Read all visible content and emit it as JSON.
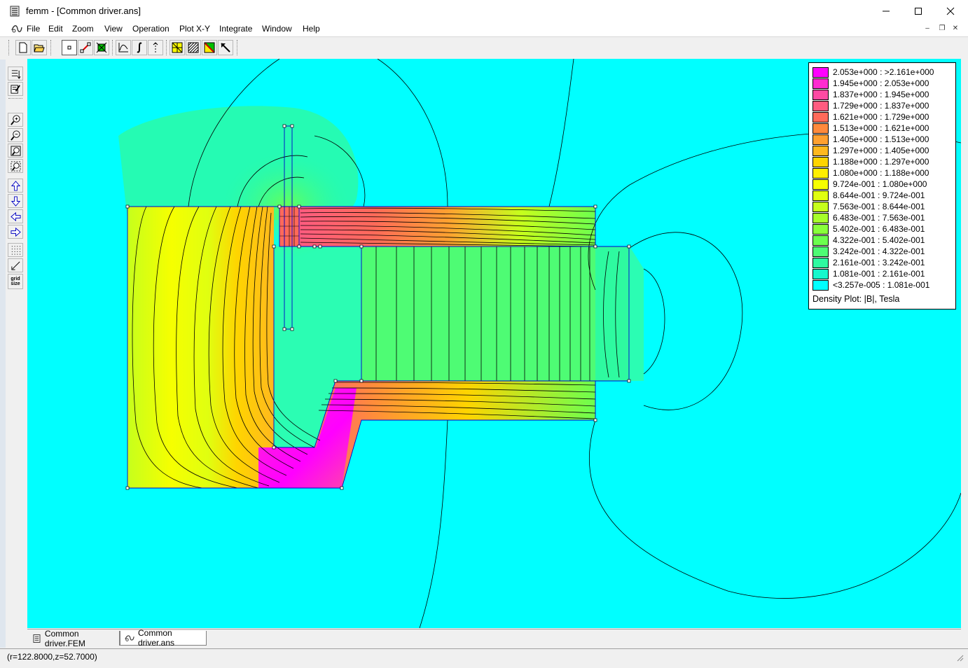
{
  "window": {
    "title": "femm - [Common driver.ans]",
    "app": "femm"
  },
  "menu": [
    "File",
    "Edit",
    "Zoom",
    "View",
    "Operation",
    "Plot X-Y",
    "Integrate",
    "Window",
    "Help"
  ],
  "toolbar": {
    "buttons": [
      "new-file-icon",
      "open-folder-icon",
      "point-mode-icon",
      "contour-mode-icon",
      "area-mode-icon",
      "plot-xy-icon",
      "integrate-icon",
      "line-integral-icon",
      "show-mesh-icon",
      "show-density-icon",
      "show-vector-icon",
      "select-arrow-icon"
    ]
  },
  "left_toolbar": {
    "buttons": [
      "show-points-icon",
      "edit-icon",
      "zoom-in-icon",
      "zoom-out-icon",
      "zoom-natural-icon",
      "zoom-window-icon",
      "pan-up-icon",
      "pan-down-icon",
      "pan-left-icon",
      "pan-right-icon",
      "grid-show-icon",
      "snap-grid-icon",
      "grid-size-icon"
    ],
    "grid_size_label": "grid size"
  },
  "legend": {
    "rows": [
      {
        "label": "2.053e+000 : >2.161e+000",
        "color": "#ff00ff"
      },
      {
        "label": "1.945e+000 : 2.053e+000",
        "color": "#ff2cd0"
      },
      {
        "label": "1.837e+000 : 1.945e+000",
        "color": "#ff4aa3"
      },
      {
        "label": "1.729e+000 : 1.837e+000",
        "color": "#ff5c80"
      },
      {
        "label": "1.621e+000 : 1.729e+000",
        "color": "#ff6a5a"
      },
      {
        "label": "1.513e+000 : 1.621e+000",
        "color": "#ff8a3c"
      },
      {
        "label": "1.405e+000 : 1.513e+000",
        "color": "#ffa030"
      },
      {
        "label": "1.297e+000 : 1.405e+000",
        "color": "#ffb81e"
      },
      {
        "label": "1.188e+000 : 1.297e+000",
        "color": "#ffd400"
      },
      {
        "label": "1.080e+000 : 1.188e+000",
        "color": "#ffee00"
      },
      {
        "label": "9.724e-001 : 1.080e+000",
        "color": "#f6ff00"
      },
      {
        "label": "8.644e-001 : 9.724e-001",
        "color": "#e0ff10"
      },
      {
        "label": "7.563e-001 : 8.644e-001",
        "color": "#c6ff1c"
      },
      {
        "label": "6.483e-001 : 7.563e-001",
        "color": "#a6ff2a"
      },
      {
        "label": "5.402e-001 : 6.483e-001",
        "color": "#88ff3a"
      },
      {
        "label": "4.322e-001 : 5.402e-001",
        "color": "#6cff4e"
      },
      {
        "label": "3.242e-001 : 4.322e-001",
        "color": "#4efc74"
      },
      {
        "label": "2.161e-001 : 3.242e-001",
        "color": "#2efaa0"
      },
      {
        "label": "1.081e-001 : 2.161e-001",
        "color": "#16f8cc"
      },
      {
        "label": "<3.257e-005 : 1.081e-001",
        "color": "#00ffff"
      }
    ],
    "caption": "Density Plot: |B|, Tesla"
  },
  "tabs": [
    {
      "label": "Common driver.FEM",
      "active": false
    },
    {
      "label": "Common driver.ans",
      "active": true
    }
  ],
  "status": {
    "coords": "(r=122.8000,z=52.7000)"
  },
  "colors": {
    "background": "#00ffff",
    "boundary": "#0000cc"
  }
}
